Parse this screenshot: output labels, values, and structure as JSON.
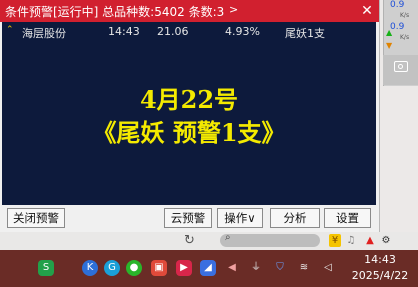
{
  "window": {
    "title": "条件预警[运行中] 总品种数:5402 条数:3",
    "title_more": ">",
    "close": "✕"
  },
  "alerts": [
    {
      "name": "海层股份",
      "time": "14:43",
      "price": "21.06",
      "change": "4.93%",
      "note": "尾妖1支"
    }
  ],
  "banner": {
    "line1": "4月22号",
    "line2": "《尾妖 预警1支》"
  },
  "buttons": {
    "close_alert": "关闭预警",
    "cloud_alert": "云预警",
    "operate": "操作∨",
    "analyze": "分析",
    "settings": "设置"
  },
  "gadget": {
    "upload_value": "0.9",
    "upload_unit": "K/s",
    "download_value": "0.9",
    "download_unit": "K/s"
  },
  "clock": {
    "time": "14:43",
    "date": "2025/4/22"
  },
  "colors": {
    "title_bar": "#d1202f",
    "alert_bg": "#0d1a3c",
    "banner_text": "#f4ea00",
    "taskbar": "#6a2c26"
  }
}
